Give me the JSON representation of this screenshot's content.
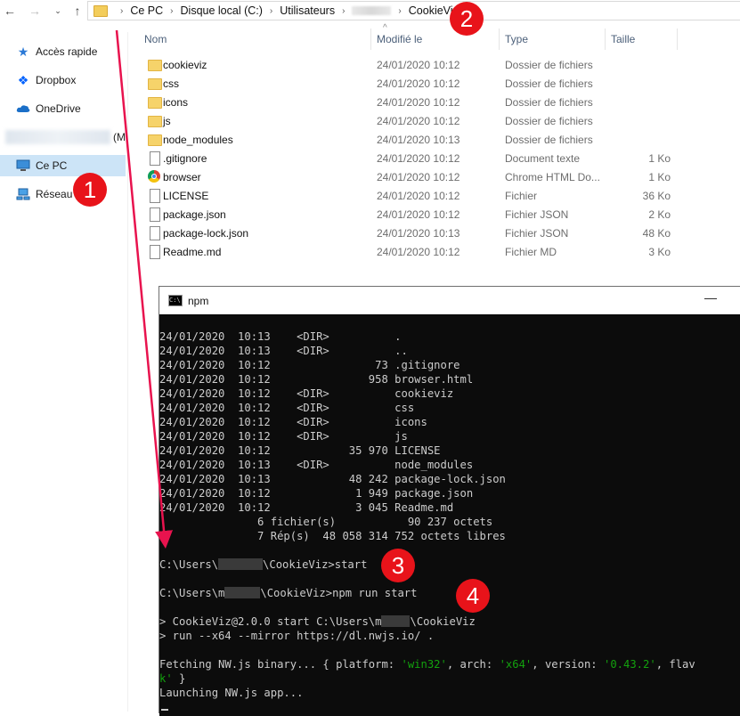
{
  "explorer": {
    "breadcrumb": [
      "Ce PC",
      "Disque local (C:)",
      "Utilisateurs",
      "CookieViz"
    ],
    "sidebar": [
      {
        "label": "Accès rapide",
        "icon": "star-icon"
      },
      {
        "label": "Dropbox",
        "icon": "dropbox-icon"
      },
      {
        "label": "OneDrive",
        "icon": "cloud-icon"
      },
      {
        "label": "(M",
        "icon": "blurred-item"
      },
      {
        "label": "Ce PC",
        "icon": "computer-icon"
      },
      {
        "label": "Réseau",
        "icon": "network-icon"
      }
    ],
    "columns": [
      "Nom",
      "Modifié le",
      "Type",
      "Taille"
    ],
    "files": [
      {
        "name": "cookieviz",
        "date": "24/01/2020 10:12",
        "type": "Dossier de fichiers",
        "size": "",
        "icon": "folder-icon"
      },
      {
        "name": "css",
        "date": "24/01/2020 10:12",
        "type": "Dossier de fichiers",
        "size": "",
        "icon": "folder-icon"
      },
      {
        "name": "icons",
        "date": "24/01/2020 10:12",
        "type": "Dossier de fichiers",
        "size": "",
        "icon": "folder-icon"
      },
      {
        "name": "js",
        "date": "24/01/2020 10:12",
        "type": "Dossier de fichiers",
        "size": "",
        "icon": "folder-icon"
      },
      {
        "name": "node_modules",
        "date": "24/01/2020 10:13",
        "type": "Dossier de fichiers",
        "size": "",
        "icon": "folder-icon"
      },
      {
        "name": ".gitignore",
        "date": "24/01/2020 10:12",
        "type": "Document texte",
        "size": "1 Ko",
        "icon": "file-icon"
      },
      {
        "name": "browser",
        "date": "24/01/2020 10:12",
        "type": "Chrome HTML Do...",
        "size": "1 Ko",
        "icon": "chrome-icon"
      },
      {
        "name": "LICENSE",
        "date": "24/01/2020 10:12",
        "type": "Fichier",
        "size": "36 Ko",
        "icon": "file-icon"
      },
      {
        "name": "package.json",
        "date": "24/01/2020 10:12",
        "type": "Fichier JSON",
        "size": "2 Ko",
        "icon": "file-icon"
      },
      {
        "name": "package-lock.json",
        "date": "24/01/2020 10:13",
        "type": "Fichier JSON",
        "size": "48 Ko",
        "icon": "file-icon"
      },
      {
        "name": "Readme.md",
        "date": "24/01/2020 10:12",
        "type": "Fichier MD",
        "size": "3 Ko",
        "icon": "file-icon"
      }
    ]
  },
  "console": {
    "title": "npm",
    "minimize": "—",
    "dir_lines": [
      "24/01/2020  10:13    <DIR>          .",
      "24/01/2020  10:13    <DIR>          ..",
      "24/01/2020  10:12                73 .gitignore",
      "24/01/2020  10:12               958 browser.html",
      "24/01/2020  10:12    <DIR>          cookieviz",
      "24/01/2020  10:12    <DIR>          css",
      "24/01/2020  10:12    <DIR>          icons",
      "24/01/2020  10:12    <DIR>          js",
      "24/01/2020  10:12            35 970 LICENSE",
      "24/01/2020  10:13    <DIR>          node_modules",
      "24/01/2020  10:13            48 242 package-lock.json",
      "24/01/2020  10:12             1 949 package.json",
      "24/01/2020  10:12             3 045 Readme.md",
      "               6 fichier(s)           90 237 octets",
      "               7 Rép(s)  48 058 314 752 octets libres"
    ],
    "prompt1_a": "C:\\Users\\",
    "prompt1_b": "\\CookieViz>start",
    "prompt2_a": "C:\\Users\\m",
    "prompt2_b": "\\CookieViz>npm run start",
    "npm1_a": "> CookieViz@2.0.0 start C:\\Users\\m",
    "npm1_b": "\\CookieViz",
    "npm2": "> run --x64 --mirror https://dl.nwjs.io/ .",
    "fetch_a": "Fetching NW.js binary... { platform: ",
    "fetch_platform": "'win32'",
    "fetch_b": ", arch: ",
    "fetch_arch": "'x64'",
    "fetch_c": ", version: ",
    "fetch_version": "'0.43.2'",
    "fetch_d": ", flav",
    "fetch_wrap_green": "k'",
    "fetch_wrap_rest": " }",
    "launching": "Launching NW.js app..."
  },
  "annotations": [
    "1",
    "2",
    "3",
    "4"
  ],
  "colors": {
    "annotation": "#e8131a",
    "selection": "#cce4f7",
    "console_bg": "#0c0c0c",
    "console_green": "#13a10e"
  }
}
